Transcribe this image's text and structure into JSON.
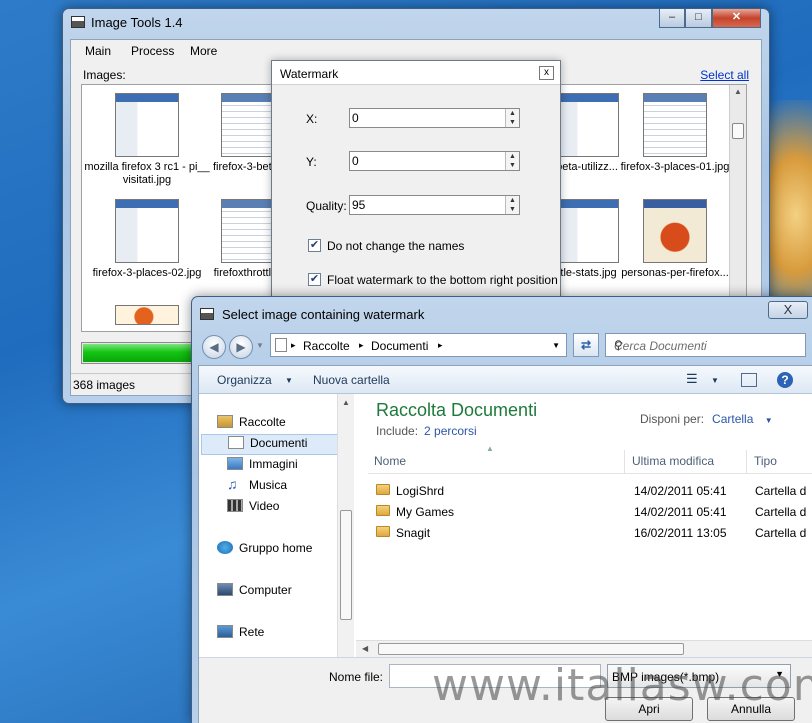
{
  "main_window": {
    "title": "Image Tools 1.4",
    "menu": [
      "Main",
      "Process",
      "More"
    ],
    "images_label": "Images:",
    "select_all": "Select all",
    "thumbnails": [
      {
        "caption": "mozilla firefox 3 rc1 - pi__ visitati.jpg",
        "style": "plain"
      },
      {
        "caption": "firefox-3-beta-co",
        "style": "alt"
      },
      {
        "caption": "beta-utilizz...",
        "style": "plain"
      },
      {
        "caption": "firefox-3-places-01.jpg",
        "style": "alt"
      },
      {
        "caption": "firefox-3-places-02.jpg",
        "style": "plain"
      },
      {
        "caption": "firefoxthrottle-ex",
        "style": "alt"
      },
      {
        "caption": "ttle-stats.jpg",
        "style": "plain"
      },
      {
        "caption": "personas-per-firefox...",
        "style": "red"
      },
      {
        "caption": "",
        "style": "fox"
      }
    ],
    "progress_fraction": 0.97,
    "status": "368 images"
  },
  "watermark_dialog": {
    "title": "Watermark",
    "close": "x",
    "fields": [
      {
        "label": "X:",
        "value": "0"
      },
      {
        "label": "Y:",
        "value": "0"
      },
      {
        "label": "Quality:",
        "value": "95"
      }
    ],
    "checkboxes": [
      {
        "label": "Do not change the names",
        "checked": true
      },
      {
        "label": "Float watermark to the bottom right position",
        "checked": true
      }
    ]
  },
  "file_dialog": {
    "title": "Select image containing watermark",
    "close": "X",
    "address": [
      "Raccolte",
      "Documenti"
    ],
    "search_placeholder": "Cerca Documenti",
    "toolbar": {
      "organize": "Organizza",
      "new_folder": "Nuova cartella"
    },
    "nav": {
      "libraries": "Raccolte",
      "documents": "Documenti",
      "images": "Immagini",
      "music": "Musica",
      "video": "Video",
      "homegroup": "Gruppo home",
      "computer": "Computer",
      "network": "Rete"
    },
    "library_title": "Raccolta Documenti",
    "include_label": "Include:",
    "include_link": "2 percorsi",
    "arrange_label": "Disponi per:",
    "arrange_value": "Cartella",
    "columns": [
      "Nome",
      "Ultima modifica",
      "Tipo"
    ],
    "files": [
      {
        "name": "LogiShrd",
        "modified": "14/02/2011 05:41",
        "type": "Cartella d"
      },
      {
        "name": "My Games",
        "modified": "14/02/2011 05:41",
        "type": "Cartella d"
      },
      {
        "name": "Snagit",
        "modified": "16/02/2011 13:05",
        "type": "Cartella d"
      }
    ],
    "filename_label": "Nome file:",
    "filename_value": "",
    "filetype": "BMP images(*.bmp)",
    "open_button": "Apri",
    "cancel_button": "Annulla"
  },
  "site_watermark": "www.italiasw.com"
}
